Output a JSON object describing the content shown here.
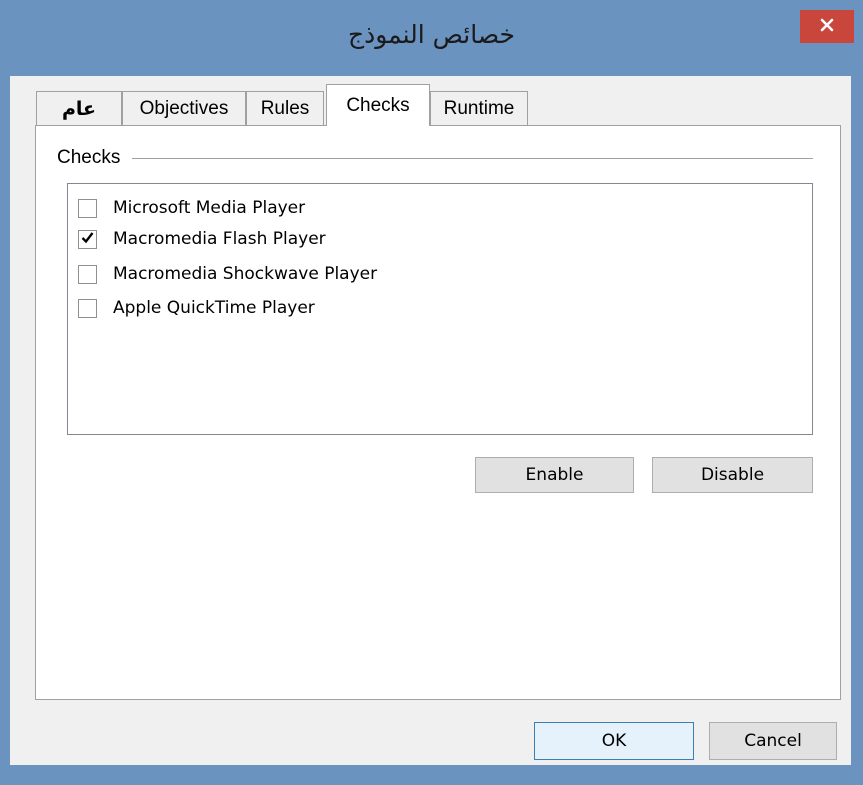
{
  "window": {
    "title": "خصائص النموذج",
    "close_symbol": "✕"
  },
  "tabs": [
    {
      "label": "عام",
      "active": false
    },
    {
      "label": "Objectives",
      "active": false
    },
    {
      "label": "Rules",
      "active": false
    },
    {
      "label": "Checks",
      "active": true
    },
    {
      "label": "Runtime",
      "active": false
    }
  ],
  "checks_group": {
    "label": "Checks",
    "items": [
      {
        "label": "Microsoft Media Player",
        "checked": false
      },
      {
        "label": "Macromedia Flash Player",
        "checked": true
      },
      {
        "label": "Macromedia Shockwave Player",
        "checked": false
      },
      {
        "label": "Apple QuickTime Player",
        "checked": false
      }
    ],
    "enable_label": "Enable",
    "disable_label": "Disable"
  },
  "footer": {
    "ok_label": "OK",
    "cancel_label": "Cancel"
  },
  "colors": {
    "titlebar": "#6b93c0",
    "close_button": "#c9463d",
    "client": "#f0f0f0"
  }
}
